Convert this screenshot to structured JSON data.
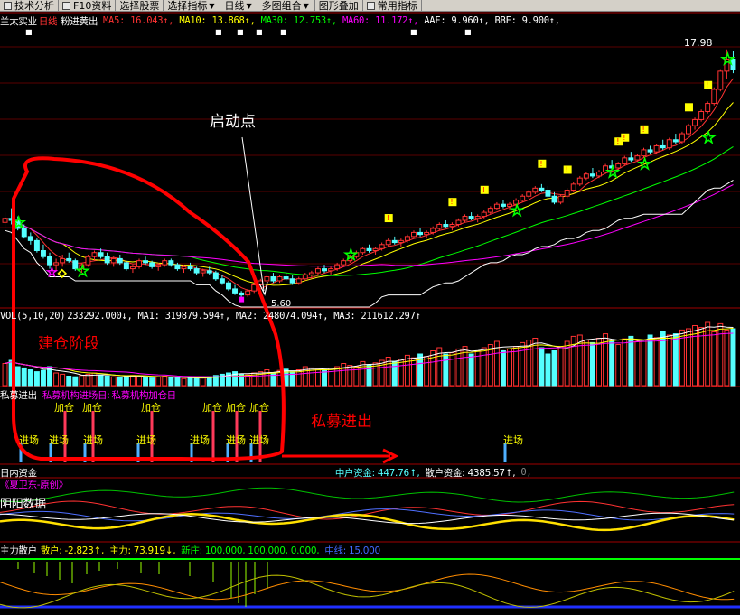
{
  "toolbar": {
    "items": [
      {
        "label": "技术分析",
        "icon": "chart-icon"
      },
      {
        "label": "F10资料",
        "icon": "doc-icon"
      },
      {
        "label": "选择股票",
        "icon": ""
      },
      {
        "label": "选择指标",
        "icon": ""
      },
      {
        "label": "日线",
        "icon": ""
      },
      {
        "label": "多图组合",
        "icon": ""
      },
      {
        "label": "图形叠加",
        "icon": ""
      },
      {
        "label": "常用指标",
        "icon": "gear-icon"
      }
    ]
  },
  "main_header": {
    "stock_name": "兰太实业",
    "period": "日线",
    "indicator_name": "粉进黄出",
    "ma5": "MA5: 16.043↑,",
    "ma10": "MA10: 13.868↑,",
    "ma30": "MA30: 12.753↑,",
    "ma60": "MA60: 11.172↑,",
    "aaf": "AAF: 9.960↑,",
    "bbf": "BBF: 9.900↑,"
  },
  "price_labels": {
    "high": "17.98",
    "low": "5.60"
  },
  "vol_header": {
    "name": "VOL(5,10,20)",
    "vol": "233292.000↓,",
    "ma1": "MA1: 319879.594↑,",
    "ma2": "MA2: 248074.094↑,",
    "ma3": "MA3: 211612.297↑"
  },
  "private_header": {
    "name": "私募进出",
    "entry_day": "私募机构进场日:",
    "add_day": "私募机构加仓日"
  },
  "signals": {
    "add_label": "加仓",
    "entry_label": "进场"
  },
  "money_header": {
    "name": "日内资金",
    "mid": "中户资金: 447.76↑,",
    "retail": "散户资金: 4385.57↑,",
    "zero": "0,"
  },
  "yinyang_header": {
    "author": "《夏卫东-原创》",
    "name": "阴阳数据"
  },
  "main_force_header": {
    "name": "主力散户",
    "retail": "散户: -2.823↑,",
    "main": "主力: 73.919↓,",
    "new_high": "新庄: 100.000, 100.000, 0.000,",
    "mid_line": "中线: 15.000"
  },
  "annotations": {
    "launch_point": "启动点",
    "build_phase": "建仓阶段",
    "private_inout": "私募进出"
  },
  "colors": {
    "up": "#ff3232",
    "down": "#54ffff",
    "ma5": "#ffffff",
    "ma10": "#ffff00",
    "ma30": "#ff00ff",
    "ma60": "#00ff00",
    "grid": "#8b0000",
    "annot_red": "#ff0000"
  },
  "chart_data": {
    "type": "candlestick",
    "title": "兰太实业 日线",
    "price_range": [
      5.2,
      19.0
    ],
    "ohlc": [
      [
        9.4,
        9.9,
        9.1,
        9.6
      ],
      [
        9.6,
        10.1,
        9.3,
        9.5
      ],
      [
        9.5,
        9.7,
        9.0,
        9.1
      ],
      [
        9.1,
        9.3,
        8.6,
        8.7
      ],
      [
        8.7,
        8.9,
        8.3,
        8.5
      ],
      [
        8.5,
        8.6,
        7.9,
        8.0
      ],
      [
        8.0,
        8.3,
        7.6,
        7.7
      ],
      [
        7.7,
        7.9,
        7.1,
        7.3
      ],
      [
        7.3,
        7.6,
        7.0,
        7.4
      ],
      [
        7.4,
        7.8,
        7.2,
        7.6
      ],
      [
        7.6,
        7.9,
        7.4,
        7.5
      ],
      [
        7.5,
        7.6,
        7.0,
        7.1
      ],
      [
        7.1,
        7.4,
        6.9,
        7.3
      ],
      [
        7.3,
        7.8,
        7.2,
        7.7
      ],
      [
        7.7,
        8.0,
        7.5,
        7.9
      ],
      [
        7.9,
        8.1,
        7.6,
        7.7
      ],
      [
        7.7,
        7.9,
        7.3,
        7.4
      ],
      [
        7.4,
        7.7,
        7.2,
        7.6
      ],
      [
        7.6,
        7.8,
        7.3,
        7.4
      ],
      [
        7.4,
        7.5,
        7.0,
        7.1
      ],
      [
        7.1,
        7.3,
        6.9,
        7.2
      ],
      [
        7.2,
        7.6,
        7.1,
        7.5
      ],
      [
        7.5,
        7.7,
        7.3,
        7.4
      ],
      [
        7.4,
        7.5,
        7.1,
        7.2
      ],
      [
        7.2,
        7.4,
        7.0,
        7.3
      ],
      [
        7.3,
        7.6,
        7.2,
        7.5
      ],
      [
        7.5,
        7.6,
        7.2,
        7.3
      ],
      [
        7.3,
        7.4,
        7.0,
        7.1
      ],
      [
        7.1,
        7.3,
        6.9,
        7.2
      ],
      [
        7.2,
        7.4,
        7.0,
        7.1
      ],
      [
        7.1,
        7.2,
        6.8,
        6.9
      ],
      [
        6.9,
        7.1,
        6.7,
        7.0
      ],
      [
        7.0,
        7.2,
        6.8,
        6.9
      ],
      [
        6.9,
        7.0,
        6.5,
        6.6
      ],
      [
        6.6,
        6.8,
        6.3,
        6.4
      ],
      [
        6.4,
        6.5,
        6.0,
        6.1
      ],
      [
        6.1,
        6.3,
        5.8,
        5.9
      ],
      [
        5.9,
        6.0,
        5.6,
        5.8
      ],
      [
        5.8,
        6.1,
        5.7,
        6.0
      ],
      [
        6.0,
        6.4,
        5.9,
        6.3
      ],
      [
        6.3,
        6.6,
        6.2,
        6.5
      ],
      [
        6.5,
        6.8,
        6.3,
        6.7
      ],
      [
        6.7,
        6.9,
        6.4,
        6.5
      ],
      [
        6.5,
        6.8,
        6.4,
        6.7
      ],
      [
        6.7,
        6.9,
        6.5,
        6.6
      ],
      [
        6.6,
        6.8,
        6.3,
        6.4
      ],
      [
        6.4,
        6.7,
        6.3,
        6.6
      ],
      [
        6.6,
        6.9,
        6.5,
        6.8
      ],
      [
        6.8,
        7.0,
        6.6,
        6.9
      ],
      [
        6.9,
        7.2,
        6.8,
        7.1
      ],
      [
        7.1,
        7.3,
        6.9,
        7.0
      ],
      [
        7.0,
        7.2,
        6.8,
        7.1
      ],
      [
        7.1,
        7.4,
        7.0,
        7.3
      ],
      [
        7.3,
        7.6,
        7.2,
        7.5
      ],
      [
        7.5,
        7.8,
        7.4,
        7.7
      ],
      [
        7.7,
        8.0,
        7.6,
        7.9
      ],
      [
        7.9,
        8.2,
        7.8,
        8.1
      ],
      [
        8.1,
        8.3,
        7.9,
        8.0
      ],
      [
        8.0,
        8.2,
        7.8,
        8.1
      ],
      [
        8.1,
        8.4,
        8.0,
        8.3
      ],
      [
        8.3,
        8.6,
        8.2,
        8.5
      ],
      [
        8.5,
        8.7,
        8.3,
        8.4
      ],
      [
        8.4,
        8.6,
        8.2,
        8.5
      ],
      [
        8.5,
        8.8,
        8.4,
        8.7
      ],
      [
        8.7,
        9.0,
        8.6,
        8.9
      ],
      [
        8.9,
        9.1,
        8.7,
        8.8
      ],
      [
        8.8,
        9.0,
        8.6,
        8.9
      ],
      [
        8.9,
        9.2,
        8.8,
        9.1
      ],
      [
        9.1,
        9.4,
        9.0,
        9.3
      ],
      [
        9.3,
        9.5,
        9.1,
        9.2
      ],
      [
        9.2,
        9.4,
        9.0,
        9.3
      ],
      [
        9.3,
        9.6,
        9.2,
        9.5
      ],
      [
        9.5,
        9.8,
        9.4,
        9.7
      ],
      [
        9.7,
        9.9,
        9.5,
        9.6
      ],
      [
        9.6,
        9.8,
        9.4,
        9.7
      ],
      [
        9.7,
        10.0,
        9.6,
        9.9
      ],
      [
        9.9,
        10.2,
        9.8,
        10.1
      ],
      [
        10.1,
        10.4,
        10.0,
        10.3
      ],
      [
        10.3,
        10.5,
        10.1,
        10.2
      ],
      [
        10.2,
        10.4,
        10.0,
        10.3
      ],
      [
        10.3,
        10.6,
        10.2,
        10.5
      ],
      [
        10.5,
        10.8,
        10.4,
        10.7
      ],
      [
        10.7,
        11.0,
        10.6,
        10.9
      ],
      [
        10.9,
        11.2,
        10.8,
        11.1
      ],
      [
        11.1,
        11.3,
        10.9,
        11.0
      ],
      [
        11.0,
        11.2,
        10.6,
        10.7
      ],
      [
        10.7,
        10.9,
        10.3,
        10.4
      ],
      [
        10.4,
        10.8,
        10.3,
        10.7
      ],
      [
        10.7,
        11.1,
        10.6,
        11.0
      ],
      [
        11.0,
        11.4,
        10.9,
        11.3
      ],
      [
        11.3,
        11.7,
        11.2,
        11.6
      ],
      [
        11.6,
        11.9,
        11.5,
        11.8
      ],
      [
        11.8,
        12.1,
        11.6,
        11.7
      ],
      [
        11.7,
        12.0,
        11.6,
        11.9
      ],
      [
        11.9,
        12.3,
        11.8,
        12.2
      ],
      [
        12.2,
        12.5,
        12.0,
        12.1
      ],
      [
        12.1,
        12.4,
        12.0,
        12.3
      ],
      [
        12.3,
        12.7,
        12.2,
        12.6
      ],
      [
        12.6,
        12.9,
        12.4,
        12.5
      ],
      [
        12.5,
        12.8,
        12.4,
        12.7
      ],
      [
        12.7,
        13.1,
        12.6,
        13.0
      ],
      [
        13.0,
        13.2,
        12.8,
        12.9
      ],
      [
        12.9,
        13.3,
        12.8,
        13.2
      ],
      [
        13.2,
        13.5,
        13.0,
        13.1
      ],
      [
        13.1,
        13.6,
        13.0,
        13.5
      ],
      [
        13.5,
        13.8,
        13.3,
        13.4
      ],
      [
        13.4,
        13.9,
        13.3,
        13.8
      ],
      [
        13.8,
        14.3,
        13.7,
        14.2
      ],
      [
        14.2,
        14.6,
        14.0,
        14.5
      ],
      [
        14.5,
        15.0,
        14.4,
        14.9
      ],
      [
        14.9,
        15.4,
        14.8,
        15.3
      ],
      [
        15.3,
        16.1,
        15.2,
        16.0
      ],
      [
        16.0,
        17.0,
        15.9,
        16.9
      ],
      [
        16.9,
        17.98,
        16.5,
        17.5
      ],
      [
        17.5,
        17.9,
        16.8,
        17.0
      ]
    ],
    "volume": [
      0.35,
      0.4,
      0.3,
      0.28,
      0.25,
      0.22,
      0.24,
      0.3,
      0.2,
      0.18,
      0.15,
      0.14,
      0.16,
      0.18,
      0.2,
      0.17,
      0.15,
      0.14,
      0.13,
      0.15,
      0.16,
      0.14,
      0.13,
      0.12,
      0.14,
      0.15,
      0.13,
      0.12,
      0.11,
      0.12,
      0.13,
      0.12,
      0.14,
      0.16,
      0.18,
      0.2,
      0.22,
      0.18,
      0.17,
      0.2,
      0.22,
      0.25,
      0.2,
      0.24,
      0.26,
      0.22,
      0.25,
      0.3,
      0.28,
      0.26,
      0.24,
      0.27,
      0.3,
      0.35,
      0.32,
      0.3,
      0.38,
      0.33,
      0.36,
      0.4,
      0.45,
      0.38,
      0.42,
      0.48,
      0.44,
      0.5,
      0.46,
      0.55,
      0.6,
      0.5,
      0.52,
      0.58,
      0.62,
      0.5,
      0.55,
      0.6,
      0.65,
      0.7,
      0.55,
      0.58,
      0.62,
      0.68,
      0.72,
      0.75,
      0.6,
      0.5,
      0.55,
      0.62,
      0.7,
      0.78,
      0.8,
      0.72,
      0.68,
      0.75,
      0.82,
      0.7,
      0.65,
      0.74,
      0.78,
      0.7,
      0.72,
      0.8,
      0.76,
      0.85,
      0.8,
      0.82,
      0.88,
      0.9,
      0.95,
      0.92,
      1.0,
      0.85,
      0.98,
      0.88,
      0.9
    ]
  }
}
